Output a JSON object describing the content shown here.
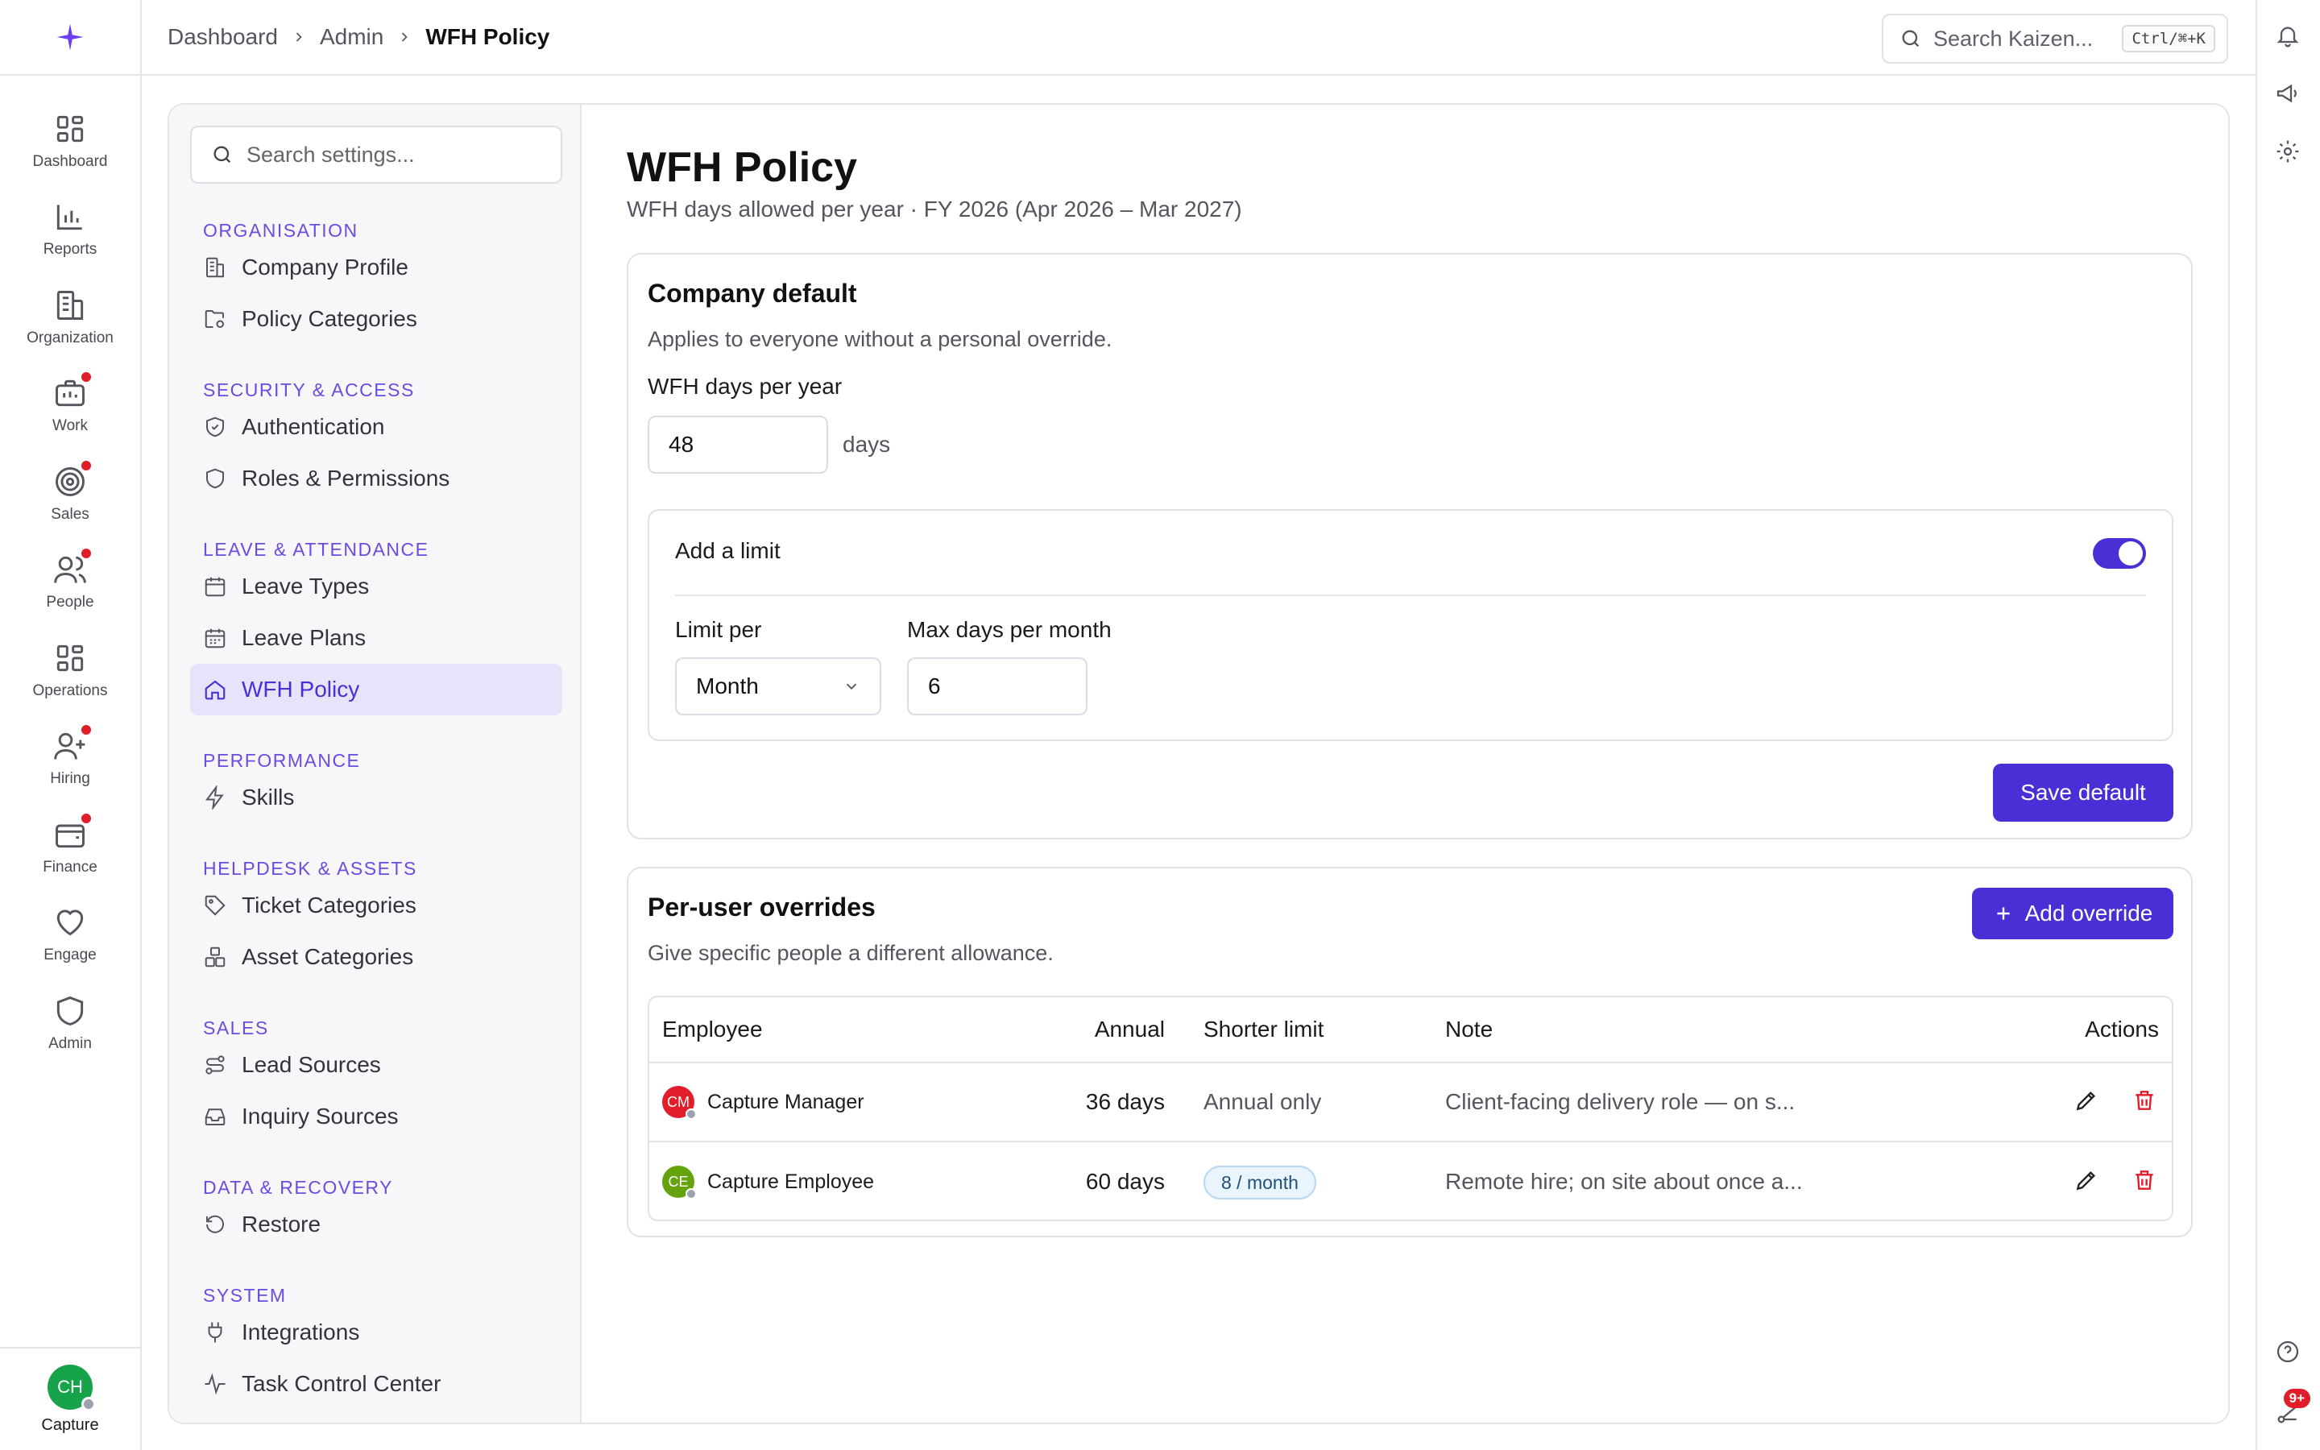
{
  "rail": {
    "items": [
      {
        "label": "Dashboard",
        "icon": "grid-icon",
        "dot": false
      },
      {
        "label": "Reports",
        "icon": "bar-chart-icon",
        "dot": false
      },
      {
        "label": "Organization",
        "icon": "building-icon",
        "dot": false
      },
      {
        "label": "Work",
        "icon": "briefcase-icon",
        "dot": true
      },
      {
        "label": "Sales",
        "icon": "target-icon",
        "dot": true
      },
      {
        "label": "People",
        "icon": "users-icon",
        "dot": true
      },
      {
        "label": "Operations",
        "icon": "grid-icon",
        "dot": false
      },
      {
        "label": "Hiring",
        "icon": "user-plus-icon",
        "dot": true
      },
      {
        "label": "Finance",
        "icon": "wallet-icon",
        "dot": true
      },
      {
        "label": "Engage",
        "icon": "heart-icon",
        "dot": false
      },
      {
        "label": "Admin",
        "icon": "shield-icon",
        "dot": false
      }
    ],
    "user": {
      "initials": "CH",
      "label": "Capture"
    }
  },
  "breadcrumb": {
    "items": [
      "Dashboard",
      "Admin",
      "WFH Policy"
    ]
  },
  "global_search": {
    "placeholder": "Search Kaizen...",
    "shortcut": "Ctrl/⌘+K"
  },
  "utility": {
    "badge": "9+"
  },
  "settings": {
    "search_placeholder": "Search settings...",
    "sections": [
      {
        "title": "ORGANISATION",
        "items": [
          {
            "label": "Company Profile",
            "icon": "building-icon"
          },
          {
            "label": "Policy Categories",
            "icon": "folder-cog-icon"
          }
        ]
      },
      {
        "title": "SECURITY & ACCESS",
        "items": [
          {
            "label": "Authentication",
            "icon": "shield-check-icon"
          },
          {
            "label": "Roles & Permissions",
            "icon": "shield-icon"
          }
        ]
      },
      {
        "title": "LEAVE & ATTENDANCE",
        "items": [
          {
            "label": "Leave Types",
            "icon": "calendar-icon"
          },
          {
            "label": "Leave Plans",
            "icon": "calendar-days-icon"
          },
          {
            "label": "WFH Policy",
            "icon": "home-icon",
            "active": true
          }
        ]
      },
      {
        "title": "PERFORMANCE",
        "items": [
          {
            "label": "Skills",
            "icon": "zap-icon"
          }
        ]
      },
      {
        "title": "HELPDESK & ASSETS",
        "items": [
          {
            "label": "Ticket Categories",
            "icon": "tag-icon"
          },
          {
            "label": "Asset Categories",
            "icon": "boxes-icon"
          }
        ]
      },
      {
        "title": "SALES",
        "items": [
          {
            "label": "Lead Sources",
            "icon": "route-icon"
          },
          {
            "label": "Inquiry Sources",
            "icon": "inbox-icon"
          }
        ]
      },
      {
        "title": "DATA & RECOVERY",
        "items": [
          {
            "label": "Restore",
            "icon": "undo-icon"
          }
        ]
      },
      {
        "title": "SYSTEM",
        "items": [
          {
            "label": "Integrations",
            "icon": "plug-icon"
          },
          {
            "label": "Task Control Center",
            "icon": "activity-icon"
          }
        ]
      }
    ]
  },
  "page": {
    "title": "WFH Policy",
    "subtitle": "WFH days allowed per year · FY 2026 (Apr 2026 – Mar 2027)"
  },
  "company_default": {
    "title": "Company default",
    "description": "Applies to everyone without a personal override.",
    "days_label": "WFH days per year",
    "days_value": "48",
    "days_unit": "days",
    "limit": {
      "label": "Add a limit",
      "enabled": true,
      "limit_per_label": "Limit per",
      "limit_per_value": "Month",
      "max_label": "Max days per month",
      "max_value": "6"
    },
    "save_label": "Save default"
  },
  "overrides": {
    "title": "Per-user overrides",
    "description": "Give specific people a different allowance.",
    "add_label": "Add override",
    "columns": [
      "Employee",
      "Annual",
      "Shorter limit",
      "Note",
      "Actions"
    ],
    "rows": [
      {
        "initials": "CM",
        "avatar_color": "#e11d2a",
        "name": "Capture Manager",
        "annual": "36 days",
        "limit": "Annual only",
        "limit_pill": false,
        "note": "Client-facing delivery role — on s..."
      },
      {
        "initials": "CE",
        "avatar_color": "#65a30d",
        "name": "Capture Employee",
        "annual": "60 days",
        "limit": "8 / month",
        "limit_pill": true,
        "note": "Remote hire; on site about once a..."
      }
    ]
  },
  "colors": {
    "accent": "#4b2fd6",
    "danger": "#e11d2a"
  }
}
